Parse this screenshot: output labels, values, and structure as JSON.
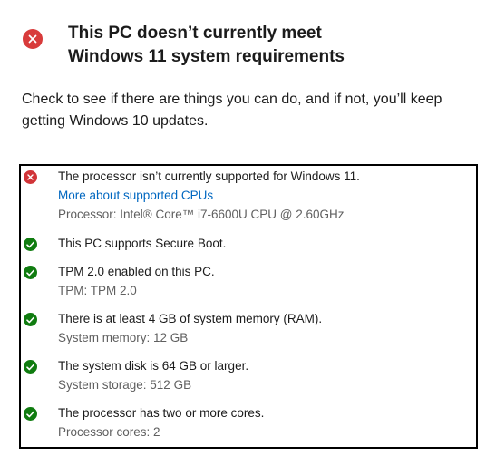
{
  "header": {
    "title_line1": "This PC doesn’t currently meet",
    "title_line2": "Windows 11 system requirements",
    "icon": "error-icon",
    "icon_color": "#d83b3b"
  },
  "subtitle": {
    "line1": "Check to see if there are things you can do, and if not, you’ll keep",
    "line2": "getting Windows 10 updates."
  },
  "checks": [
    {
      "status": "fail",
      "title": "The processor isn’t currently supported for Windows 11.",
      "link": "More about supported CPUs",
      "detail": "Processor: Intel® Core™ i7-6600U CPU @ 2.60GHz"
    },
    {
      "status": "pass",
      "title": "This PC supports Secure Boot."
    },
    {
      "status": "pass",
      "title": "TPM 2.0 enabled on this PC.",
      "detail": "TPM: TPM 2.0"
    },
    {
      "status": "pass",
      "title": "There is at least 4 GB of system memory (RAM).",
      "detail": "System memory: 12 GB"
    },
    {
      "status": "pass",
      "title": "The system disk is 64 GB or larger.",
      "detail": "System storage: 512 GB"
    },
    {
      "status": "pass",
      "title": "The processor has two or more cores.",
      "detail": "Processor cores: 2"
    }
  ],
  "colors": {
    "fail": "#d13438",
    "pass": "#107c10",
    "link": "#0067c0",
    "detail_text": "#5f5f5f"
  }
}
